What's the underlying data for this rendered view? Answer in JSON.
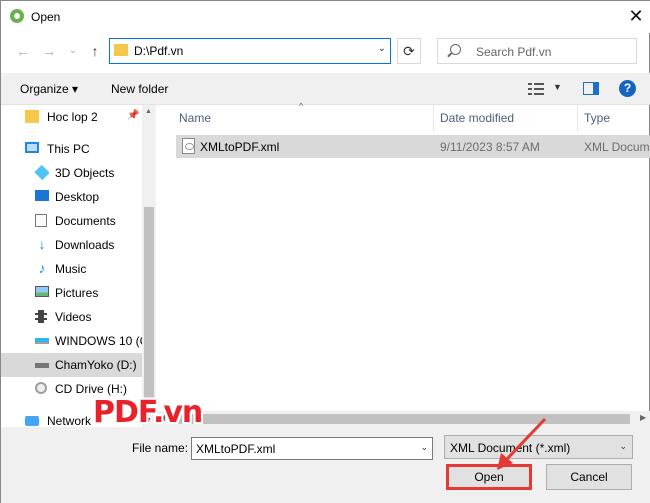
{
  "window": {
    "title": "Open",
    "app_icon": "app-icon",
    "close_glyph": "✕"
  },
  "nav": {
    "back": "←",
    "forward": "→",
    "recent": "⌄",
    "up": "↑"
  },
  "address": {
    "path": "D:\\Pdf.vn"
  },
  "search": {
    "placeholder": "Search Pdf.vn"
  },
  "command_bar": {
    "organize": "Organize ▾",
    "new_folder": "New folder",
    "help": "?"
  },
  "sidebar": {
    "items": [
      {
        "label": "Hoc lop 2",
        "icon": "folder-icon"
      },
      {
        "label": "This PC",
        "icon": "computer-icon"
      },
      {
        "label": "3D Objects",
        "icon": "cube-icon"
      },
      {
        "label": "Desktop",
        "icon": "desktop-icon"
      },
      {
        "label": "Documents",
        "icon": "document-icon"
      },
      {
        "label": "Downloads",
        "icon": "download-icon"
      },
      {
        "label": "Music",
        "icon": "music-icon"
      },
      {
        "label": "Pictures",
        "icon": "picture-icon"
      },
      {
        "label": "Videos",
        "icon": "video-icon"
      },
      {
        "label": "WINDOWS 10 (C",
        "icon": "drive-icon"
      },
      {
        "label": "ChamYoko (D:)",
        "icon": "drive-icon"
      },
      {
        "label": "CD Drive (H:)",
        "icon": "cd-drive-icon"
      },
      {
        "label": "Network",
        "icon": "network-icon"
      }
    ]
  },
  "columns": {
    "name": "Name",
    "date": "Date modified",
    "type": "Type"
  },
  "files": [
    {
      "name": "XMLtoPDF.xml",
      "date": "9/11/2023 8:57 AM",
      "type": "XML Docum"
    }
  ],
  "footer": {
    "file_name_label": "File name:",
    "file_name_value": "XMLtoPDF.xml",
    "file_type_value": "XML Document (*.xml)",
    "open": "Open",
    "cancel": "Cancel"
  },
  "watermark": {
    "text": "PDF.vn"
  },
  "colors": {
    "highlight": "#e53935",
    "accent": "#0078d7",
    "watermark": "#e8212b"
  }
}
